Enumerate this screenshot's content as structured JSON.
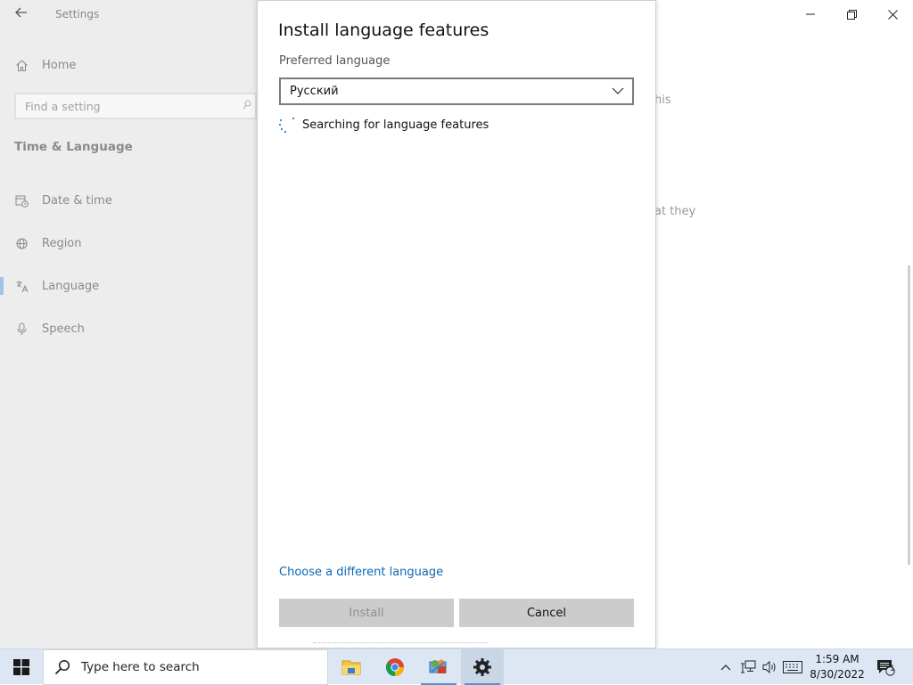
{
  "settings": {
    "title": "Settings",
    "home_label": "Home",
    "search_placeholder": "Find a setting",
    "section_title": "Time & Language",
    "nav_items": [
      {
        "label": "Date & time",
        "icon": "calendar-clock-icon"
      },
      {
        "label": "Region",
        "icon": "globe-icon"
      },
      {
        "label": "Language",
        "icon": "language-icon",
        "selected": true
      },
      {
        "label": "Speech",
        "icon": "microphone-icon"
      }
    ],
    "right_fragments": [
      "his",
      "at they"
    ],
    "window_controls": [
      "minimize",
      "restore",
      "close"
    ]
  },
  "dialog": {
    "title": "Install language features",
    "preferred_label": "Preferred language",
    "selected_language": "Русский",
    "status_text": "Searching for language features",
    "link_text": "Choose a different language",
    "install_label": "Install",
    "cancel_label": "Cancel"
  },
  "taskbar": {
    "search_placeholder": "Type here to search",
    "apps": [
      "file-explorer-icon",
      "chrome-icon",
      "control-panel-icon",
      "settings-gear-icon"
    ],
    "time": "1:59 AM",
    "date": "8/30/2022",
    "notification_count": "1"
  },
  "colors": {
    "accent": "#0067c0",
    "link": "#0a66b4",
    "taskbar_bg": "#dde7f3",
    "button_bg": "#cccccc"
  }
}
